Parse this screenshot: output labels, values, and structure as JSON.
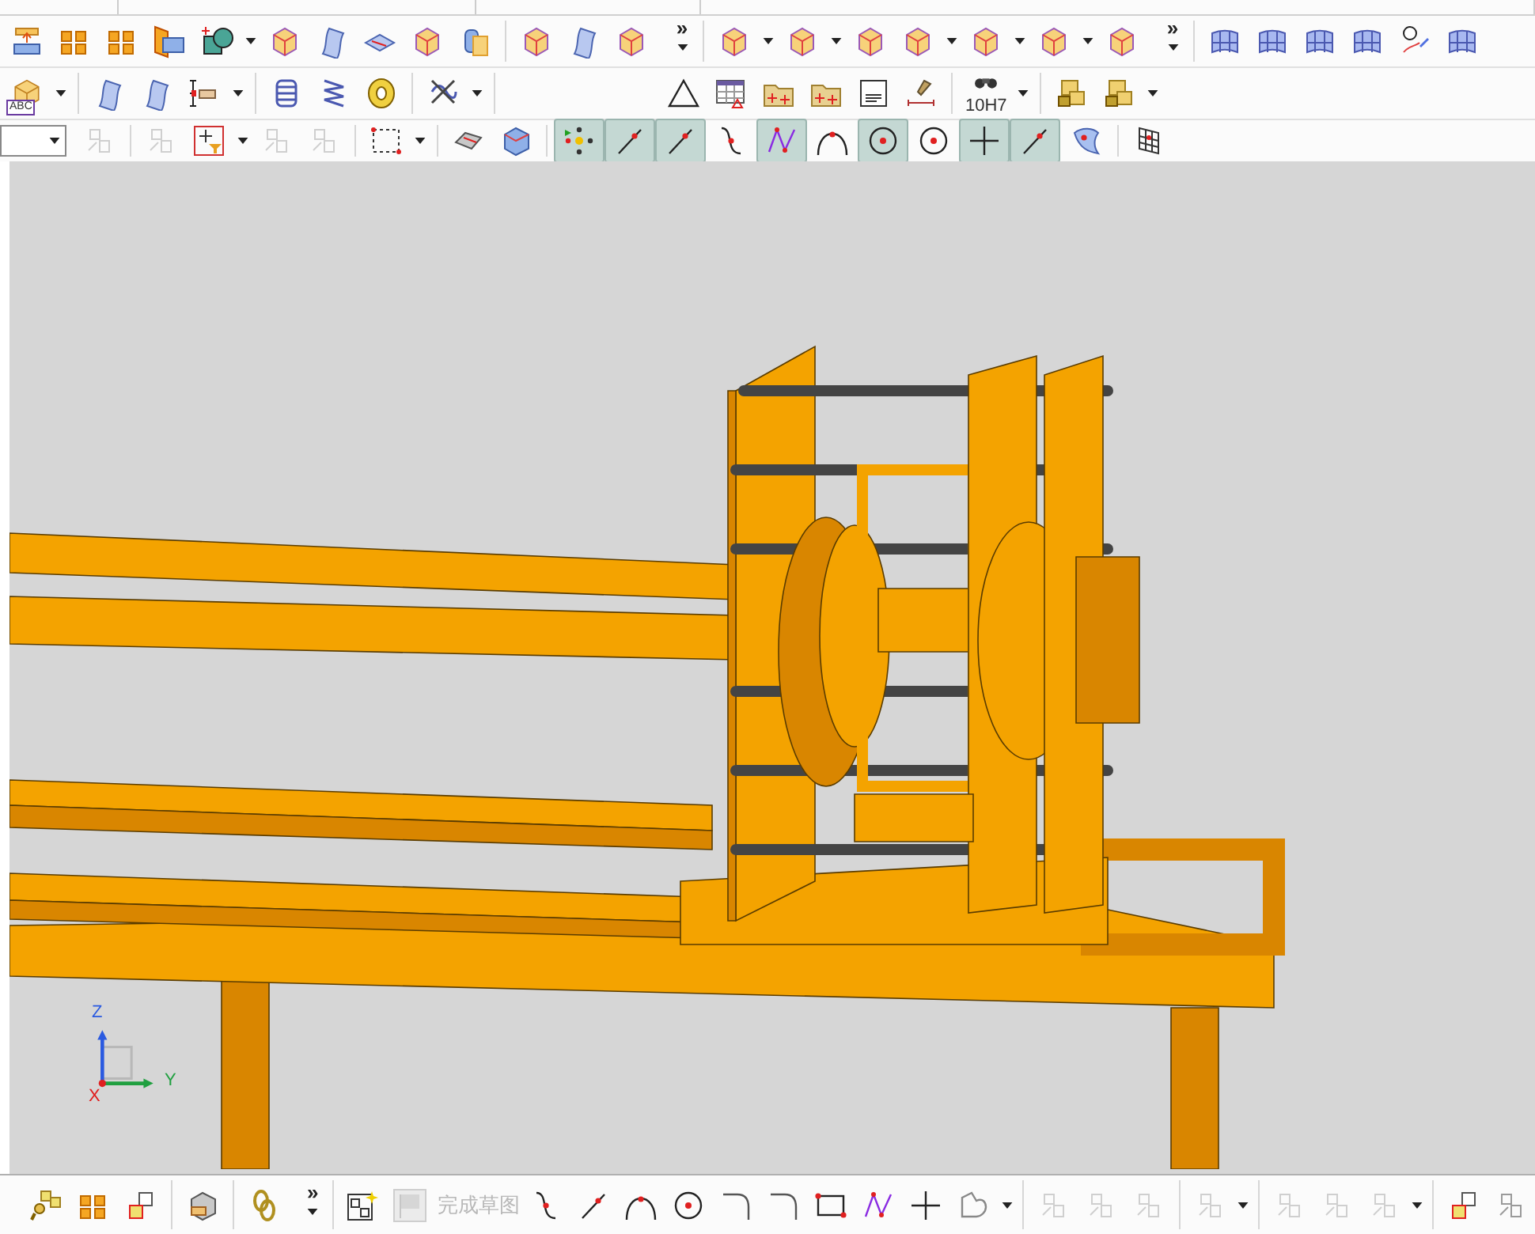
{
  "toolbar_rows": [
    {
      "groups": [
        {
          "items": [
            {
              "kind": "tool"
            },
            {
              "kind": "tool"
            },
            {
              "kind": "tool"
            },
            {
              "kind": "tool"
            },
            {
              "kind": "tool"
            },
            {
              "kind": "caret"
            },
            {
              "kind": "tool"
            },
            {
              "kind": "tool"
            },
            {
              "kind": "tool"
            },
            {
              "kind": "tool"
            },
            {
              "kind": "tool"
            }
          ]
        },
        {
          "items": [
            {
              "kind": "tool"
            },
            {
              "kind": "tool"
            },
            {
              "kind": "tool"
            },
            {
              "kind": "overflow",
              "label": "»"
            }
          ]
        },
        {
          "items": [
            {
              "kind": "tool"
            },
            {
              "kind": "caret"
            },
            {
              "kind": "tool"
            },
            {
              "kind": "caret"
            },
            {
              "kind": "tool"
            },
            {
              "kind": "tool"
            },
            {
              "kind": "caret"
            },
            {
              "kind": "tool"
            },
            {
              "kind": "caret"
            },
            {
              "kind": "tool"
            },
            {
              "kind": "caret"
            },
            {
              "kind": "tool"
            },
            {
              "kind": "overflow",
              "label": "»"
            }
          ]
        },
        {
          "items": [
            {
              "kind": "tool"
            },
            {
              "kind": "tool"
            },
            {
              "kind": "tool"
            },
            {
              "kind": "tool"
            },
            {
              "kind": "tool"
            },
            {
              "kind": "tool"
            }
          ]
        }
      ]
    },
    {
      "groups": [
        {
          "items": [
            {
              "kind": "tool",
              "label": "ABC"
            },
            {
              "kind": "caret"
            }
          ]
        },
        {
          "items": [
            {
              "kind": "tool"
            },
            {
              "kind": "tool"
            },
            {
              "kind": "tool"
            },
            {
              "kind": "caret"
            }
          ]
        },
        {
          "items": [
            {
              "kind": "tool"
            },
            {
              "kind": "tool"
            },
            {
              "kind": "tool"
            }
          ]
        },
        {
          "items": [
            {
              "kind": "tool"
            },
            {
              "kind": "caret"
            }
          ]
        },
        {
          "items": [
            {
              "kind": "tool"
            },
            {
              "kind": "tool"
            },
            {
              "kind": "tool"
            },
            {
              "kind": "tool"
            },
            {
              "kind": "tool"
            },
            {
              "kind": "tool"
            }
          ]
        },
        {
          "items": [
            {
              "kind": "tool",
              "label": "10H7"
            },
            {
              "kind": "caret"
            }
          ]
        },
        {
          "items": [
            {
              "kind": "tool"
            },
            {
              "kind": "tool"
            },
            {
              "kind": "caret"
            }
          ]
        }
      ]
    },
    {
      "groups": [
        {
          "items": [
            {
              "kind": "combo"
            },
            {
              "kind": "greyed"
            }
          ]
        },
        {
          "items": [
            {
              "kind": "greyed"
            },
            {
              "kind": "tool"
            },
            {
              "kind": "caret"
            },
            {
              "kind": "greyed"
            },
            {
              "kind": "greyed"
            }
          ]
        },
        {
          "items": [
            {
              "kind": "tool"
            },
            {
              "kind": "caret"
            }
          ]
        },
        {
          "items": [
            {
              "kind": "tool"
            },
            {
              "kind": "tool"
            }
          ]
        },
        {
          "items": [
            {
              "kind": "toggle",
              "selected": true
            },
            {
              "kind": "toggle",
              "selected": true
            },
            {
              "kind": "toggle",
              "selected": true
            },
            {
              "kind": "toggle",
              "selected": false
            },
            {
              "kind": "toggle",
              "selected": true
            },
            {
              "kind": "toggle",
              "selected": false
            },
            {
              "kind": "toggle",
              "selected": true
            },
            {
              "kind": "toggle",
              "selected": false
            },
            {
              "kind": "toggle",
              "selected": true
            },
            {
              "kind": "toggle",
              "selected": true
            },
            {
              "kind": "toggle",
              "selected": false
            }
          ]
        },
        {
          "items": [
            {
              "kind": "tool"
            }
          ]
        }
      ]
    }
  ],
  "viewport": {
    "axes": [
      {
        "label": "Z"
      },
      {
        "label": "Y"
      },
      {
        "label": "X"
      }
    ]
  },
  "bottom_toolbar": {
    "groups": [
      {
        "items": [
          {
            "kind": "tool"
          },
          {
            "kind": "tool"
          },
          {
            "kind": "tool"
          }
        ]
      },
      {
        "items": [
          {
            "kind": "tool"
          }
        ]
      },
      {
        "items": [
          {
            "kind": "tool"
          },
          {
            "kind": "overflow",
            "label": "»"
          }
        ]
      },
      {
        "items": [
          {
            "kind": "tool"
          },
          {
            "kind": "greyed"
          },
          {
            "kind": "caption",
            "label": "完成草图"
          },
          {
            "kind": "tool"
          },
          {
            "kind": "tool"
          },
          {
            "kind": "tool"
          },
          {
            "kind": "tool"
          },
          {
            "kind": "tool"
          },
          {
            "kind": "tool"
          },
          {
            "kind": "tool"
          },
          {
            "kind": "tool"
          },
          {
            "kind": "tool"
          },
          {
            "kind": "tool"
          },
          {
            "kind": "caret"
          }
        ]
      },
      {
        "items": [
          {
            "kind": "greyed"
          },
          {
            "kind": "greyed"
          },
          {
            "kind": "greyed"
          }
        ]
      },
      {
        "items": [
          {
            "kind": "greyed"
          },
          {
            "kind": "caret"
          }
        ]
      },
      {
        "items": [
          {
            "kind": "greyed"
          },
          {
            "kind": "greyed"
          },
          {
            "kind": "greyed"
          },
          {
            "kind": "caret"
          }
        ]
      },
      {
        "items": [
          {
            "kind": "tool"
          },
          {
            "kind": "tool"
          }
        ]
      }
    ]
  }
}
